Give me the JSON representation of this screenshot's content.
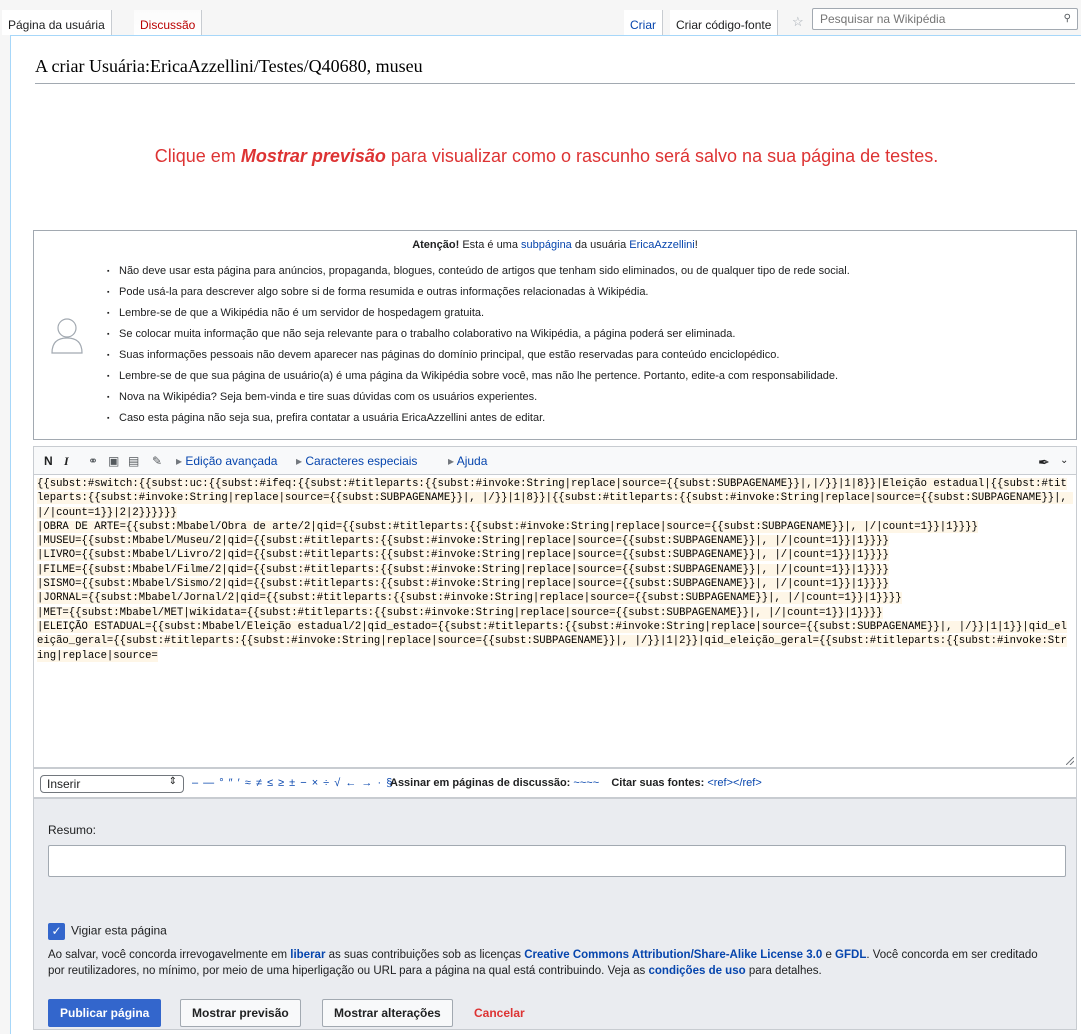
{
  "tabs": {
    "user_page": "Página da usuária",
    "discussion": "Discussão",
    "create": "Criar",
    "create_source": "Criar código-fonte",
    "search_placeholder": "Pesquisar na Wikipédia"
  },
  "heading": "A criar Usuária:EricaAzzellini/Testes/Q40680, museu",
  "notice": {
    "prefix": "Clique em ",
    "emphasis": "Mostrar previsão",
    "suffix": " para visualizar como o rascunho será salvo na sua página de testes."
  },
  "warning": {
    "title_bold": "Atenção!",
    "title_text": " Esta é uma ",
    "title_link1": "subpágina",
    "title_text2": " da usuária ",
    "title_link2": "EricaAzzellini",
    "title_end": "!",
    "items": [
      "Não deve usar esta página para anúncios, propaganda, blogues, conteúdo de artigos que tenham sido eliminados, ou de qualquer tipo de rede social.",
      "Pode usá-la para descrever algo sobre si de forma resumida e outras informações relacionadas à Wikipédia.",
      "Lembre-se de que a Wikipédia não é um servidor de hospedagem gratuita.",
      "Se colocar muita informação que não seja relevante para o trabalho colaborativo na Wikipédia, a página poderá ser eliminada.",
      "Suas informações pessoais não devem aparecer nas páginas do domínio principal, que estão reservadas para conteúdo enciclopédico.",
      "Lembre-se de que sua página de usuário(a) é uma página da Wikipédia sobre você, mas não lhe pertence. Portanto, edite-a com responsabilidade.",
      "Nova na Wikipédia? Seja bem-vinda e tire suas dúvidas com os usuários experientes.",
      "Caso esta página não seja sua, prefira contatar a usuária EricaAzzellini antes de editar."
    ]
  },
  "toolbar": {
    "bold": "N",
    "italic": "I",
    "advanced": "Edição avançada",
    "special_chars": "Caracteres especiais",
    "help": "Ajuda"
  },
  "wikitext": "{{subst:#switch:{{subst:uc:{{subst:#ifeq:{{subst:#titleparts:{{subst:#invoke:String|replace|source={{subst:SUBPAGENAME}}|,|/}}|1|8}}|Eleição estadual|{{subst:#titleparts:{{subst:#invoke:String|replace|source={{subst:SUBPAGENAME}}|, |/}}|1|8}}|{{subst:#titleparts:{{subst:#invoke:String|replace|source={{subst:SUBPAGENAME}}|, |/|count=1}}|2|2}}}}}}\n|OBRA DE ARTE={{subst:Mbabel/Obra de arte/2|qid={{subst:#titleparts:{{subst:#invoke:String|replace|source={{subst:SUBPAGENAME}}|, |/|count=1}}|1}}}}\n|MUSEU={{subst:Mbabel/Museu/2|qid={{subst:#titleparts:{{subst:#invoke:String|replace|source={{subst:SUBPAGENAME}}|, |/|count=1}}|1}}}}\n|LIVRO={{subst:Mbabel/Livro/2|qid={{subst:#titleparts:{{subst:#invoke:String|replace|source={{subst:SUBPAGENAME}}|, |/|count=1}}|1}}}}\n|FILME={{subst:Mbabel/Filme/2|qid={{subst:#titleparts:{{subst:#invoke:String|replace|source={{subst:SUBPAGENAME}}|, |/|count=1}}|1}}}}\n|SISMO={{subst:Mbabel/Sismo/2|qid={{subst:#titleparts:{{subst:#invoke:String|replace|source={{subst:SUBPAGENAME}}|, |/|count=1}}|1}}}}\n|JORNAL={{subst:Mbabel/Jornal/2|qid={{subst:#titleparts:{{subst:#invoke:String|replace|source={{subst:SUBPAGENAME}}|, |/|count=1}}|1}}}}\n|MET={{subst:Mbabel/MET|wikidata={{subst:#titleparts:{{subst:#invoke:String|replace|source={{subst:SUBPAGENAME}}|, |/|count=1}}|1}}}}\n|ELEIÇÃO ESTADUAL={{subst:Mbabel/Eleição estadual/2|qid_estado={{subst:#titleparts:{{subst:#invoke:String|replace|source={{subst:SUBPAGENAME}}|, |/}}|1|1}}|qid_eleição_geral={{subst:#titleparts:{{subst:#invoke:String|replace|source={{subst:SUBPAGENAME}}|, |/}}|1|2}}|qid_eleição_geral={{subst:#titleparts:{{subst:#invoke:String|replace|source=",
  "specialbar": {
    "insert": "Inserir",
    "chars": "– — ° ″ ′ ≈ ≠ ≤ ≥ ± − × ÷ √ ← → · §",
    "sign_label": "Assinar em páginas de discussão:",
    "sign_value": "~~~~",
    "cite_label": "Citar suas fontes:",
    "cite_value": "<ref></ref>"
  },
  "save": {
    "summary_label": "Resumo:",
    "summary_value": "",
    "watch_label": "Vigiar esta página",
    "license_text_1": "Ao salvar, você concorda irrevogavelmente em ",
    "license_link_1": "liberar",
    "license_text_2": " as suas contribuições sob as licenças ",
    "license_link_2": "Creative Commons Attribution/Share-Alike License 3.0",
    "license_text_3": " e ",
    "license_link_3": "GFDL",
    "license_text_4": ". Você concorda em ser creditado por reutilizadores, no mínimo, por meio de uma hiperligação ou URL para a página na qual está contribuindo. Veja as ",
    "license_link_4": "condições de uso",
    "license_text_5": " para detalhes.",
    "publish": "Publicar página",
    "preview": "Mostrar previsão",
    "changes": "Mostrar alterações",
    "cancel": "Cancelar"
  },
  "colors": {
    "accent": "#3366cc",
    "link": "#0645ad",
    "red": "#dd3333",
    "highlight": "#fef6e7"
  }
}
